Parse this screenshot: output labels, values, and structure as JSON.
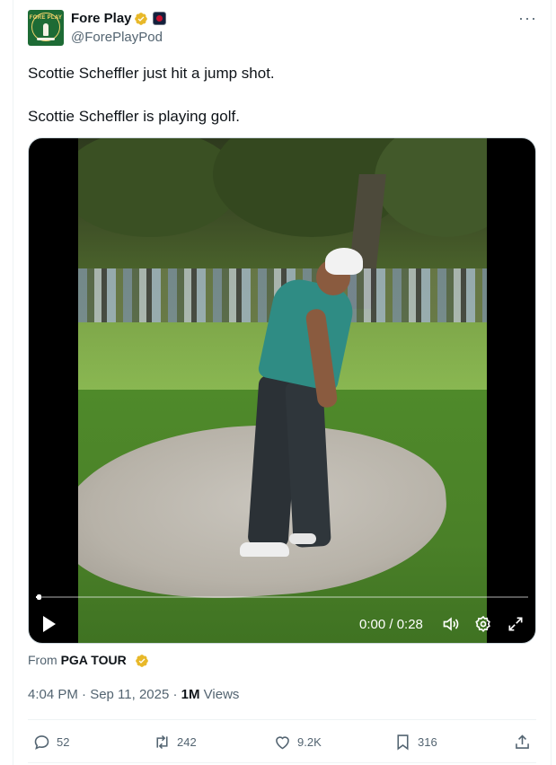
{
  "author": {
    "display_name": "Fore Play",
    "handle": "@ForePlayPod",
    "avatar_text": "FORE PLAY"
  },
  "tweet": {
    "line1": "Scottie Scheffler just hit a jump shot.",
    "line2": "Scottie Scheffler is playing golf."
  },
  "video": {
    "time": "0:00 / 0:28",
    "progress_fraction": 0.007
  },
  "source": {
    "prefix": "From ",
    "name": "PGA TOUR"
  },
  "meta": {
    "timestamp": "4:04 PM · Sep 11, 2025 · ",
    "views_count": "1M",
    "views_label": " Views"
  },
  "actions": {
    "replies": "52",
    "reposts": "242",
    "likes": "9.2K",
    "bookmarks": "316"
  },
  "colors": {
    "verified": "#e8b829",
    "text_secondary": "#536471",
    "text_primary": "#0f1419"
  },
  "icons": [
    "verified-badge-icon",
    "affiliate-badge-icon",
    "more-icon",
    "play-icon",
    "volume-icon",
    "settings-icon",
    "fullscreen-icon",
    "reply-icon",
    "repost-icon",
    "like-icon",
    "bookmark-icon",
    "share-icon"
  ]
}
